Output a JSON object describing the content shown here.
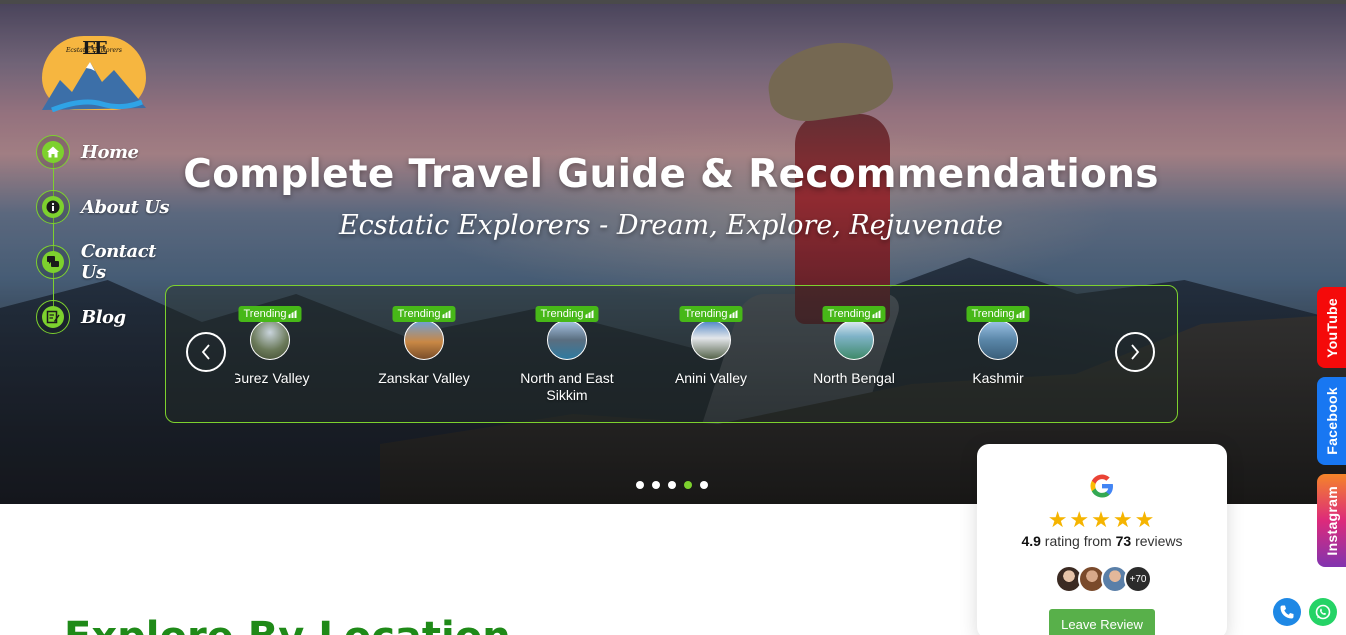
{
  "brand": {
    "logo_initials": "EE",
    "logo_text": "Ecstatic Explorers"
  },
  "nav": {
    "items": [
      {
        "label": "Home",
        "icon": "home-icon"
      },
      {
        "label": "About Us",
        "icon": "info-icon"
      },
      {
        "label": "Contact Us",
        "icon": "chat-icon"
      },
      {
        "label": "Blog",
        "icon": "edit-icon"
      }
    ]
  },
  "hero": {
    "title": "Complete Travel Guide & Recommendations",
    "subtitle": "Ecstatic Explorers - Dream, Explore, Rejuvenate"
  },
  "carousel": {
    "badge_label": "Trending",
    "locations": [
      {
        "name": "Gurez Valley"
      },
      {
        "name": "Zanskar Valley"
      },
      {
        "name": "North and East Sikkim"
      },
      {
        "name": "Anini Valley"
      },
      {
        "name": "North Bengal"
      },
      {
        "name": "Kashmir"
      }
    ],
    "prev_icon": "chevron-left-icon",
    "next_icon": "chevron-right-icon",
    "pagination": {
      "count": 5,
      "active_index": 3
    }
  },
  "social": {
    "youtube": "YouTube",
    "facebook": "Facebook",
    "instagram": "Instagram"
  },
  "review": {
    "google_letter": "G",
    "stars": "★★★★★",
    "rating_value": "4.9",
    "rating_mid": "rating from",
    "review_count": "73",
    "rating_suffix": "reviews",
    "more_count": "+70",
    "button_label": "Leave Review"
  },
  "section": {
    "title": "Explore By Location"
  },
  "colors": {
    "accent_green": "#7dd12e",
    "trending_green": "#47b818",
    "title_green": "#1f8a18",
    "youtube_red": "#f50a0a",
    "facebook_blue": "#1877f2"
  }
}
